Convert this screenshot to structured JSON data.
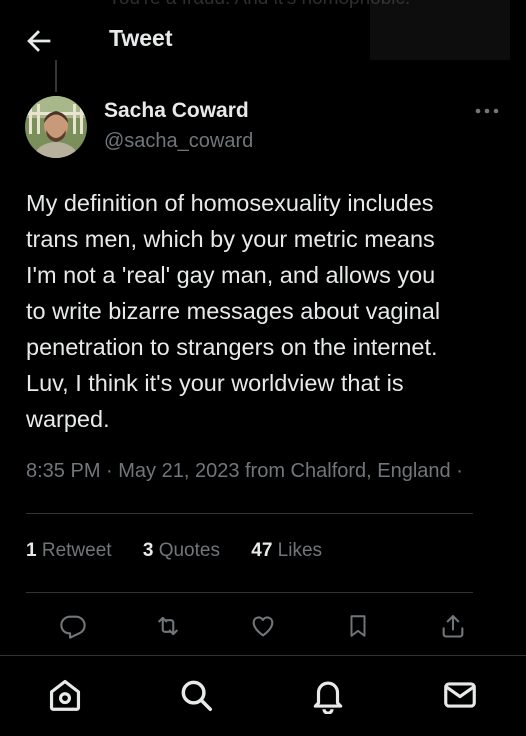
{
  "header": {
    "title": "Tweet",
    "context_text": "You're a fraud. And it's homophobic."
  },
  "tweet": {
    "author_name": "Sacha Coward",
    "author_handle": "@sacha_coward",
    "text": "My definition of homosexuality includes\ntrans men, which by your metric means\nI'm not a 'real' gay man, and allows you\nto write bizarre messages about vaginal\npenetration to strangers on the internet.\nLuv, I think it's your worldview that is\nwarped.",
    "meta": "8:35 PM · May 21, 2023 from Chalford, England ·",
    "stats": {
      "retweets_count": "1",
      "retweets_label": "Retweet",
      "quotes_count": "3",
      "quotes_label": "Quotes",
      "likes_count": "47",
      "likes_label": "Likes"
    }
  },
  "icons": {
    "back": "arrow-left-icon",
    "more": "more-icon",
    "reply": "reply-icon",
    "retweet": "retweet-icon",
    "like": "heart-icon",
    "bookmark": "bookmark-icon",
    "share": "share-icon",
    "home": "home-icon",
    "search": "search-icon",
    "notifications": "bell-icon",
    "messages": "mail-icon"
  },
  "colors": {
    "background": "#000000",
    "text": "#e7e9ea",
    "secondary": "#71767b",
    "divider": "#2f3336"
  }
}
